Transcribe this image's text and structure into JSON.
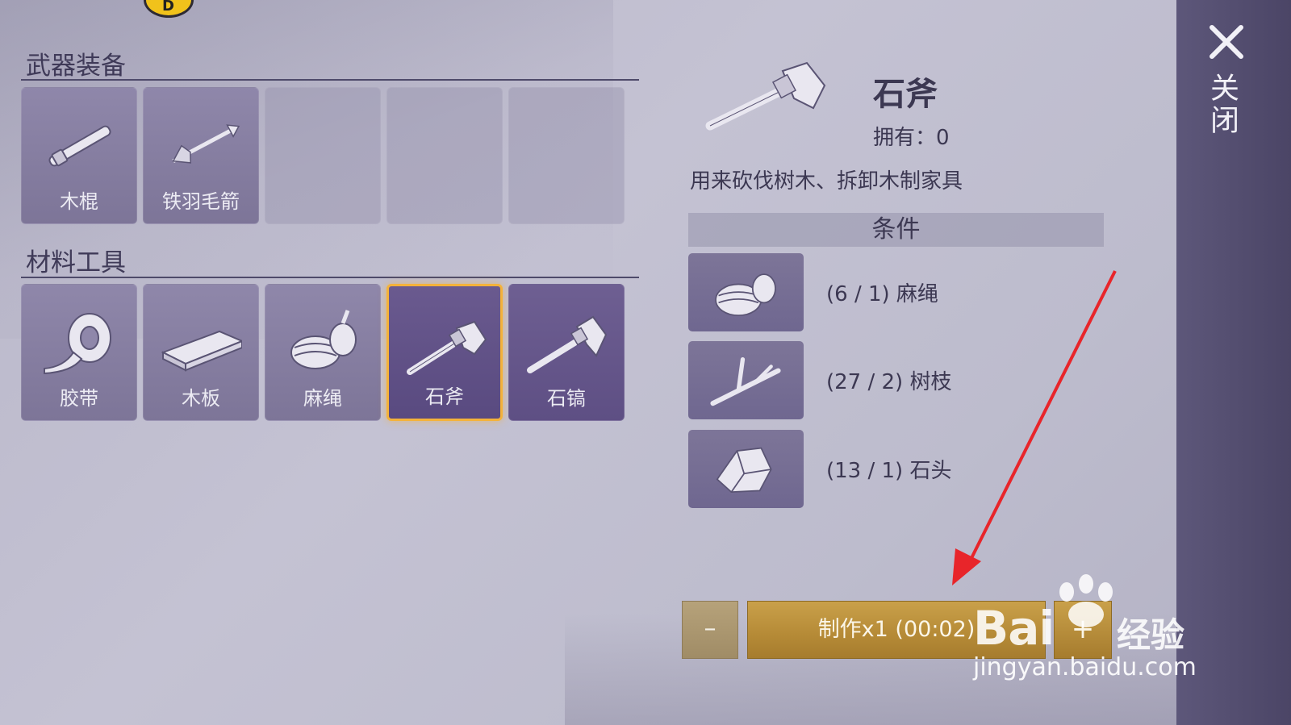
{
  "sections": {
    "weapons_title": "武器装备",
    "materials_title": "材料工具"
  },
  "weapons": [
    {
      "label": "木棍",
      "icon": "wooden-stick-icon"
    },
    {
      "label": "铁羽毛箭",
      "icon": "iron-feather-arrow-icon"
    },
    {
      "label": "",
      "icon": ""
    },
    {
      "label": "",
      "icon": ""
    },
    {
      "label": "",
      "icon": ""
    }
  ],
  "materials": [
    {
      "label": "胶带",
      "icon": "tape-icon"
    },
    {
      "label": "木板",
      "icon": "wood-plank-icon"
    },
    {
      "label": "麻绳",
      "icon": "hemp-rope-icon"
    },
    {
      "label": "石斧",
      "icon": "stone-axe-icon",
      "selected": true
    },
    {
      "label": "石镐",
      "icon": "stone-pickaxe-icon"
    }
  ],
  "detail": {
    "name": "石斧",
    "owned": "拥有：0",
    "description": "用来砍伐树木、拆卸木制家具",
    "conditions_title": "条件",
    "requirements": [
      {
        "text": "(6 / 1) 麻绳",
        "icon": "hemp-rope-icon"
      },
      {
        "text": "(27 / 2) 树枝",
        "icon": "branch-icon"
      },
      {
        "text": "(13 / 1) 石头",
        "icon": "stone-icon"
      }
    ]
  },
  "craft": {
    "minus_label": "–",
    "craft_label": "制作x1 (00:02)",
    "plus_label": "+"
  },
  "close": {
    "label": "关闭"
  },
  "watermark": {
    "logo": "Bai",
    "jingyan": "经验",
    "url": "jingyan.baidu.com"
  },
  "colors": {
    "selected_border": "#f4b23a",
    "craft_button": "#b58a36",
    "close_bar": "#4b4566",
    "arrow": "#e8252a"
  }
}
